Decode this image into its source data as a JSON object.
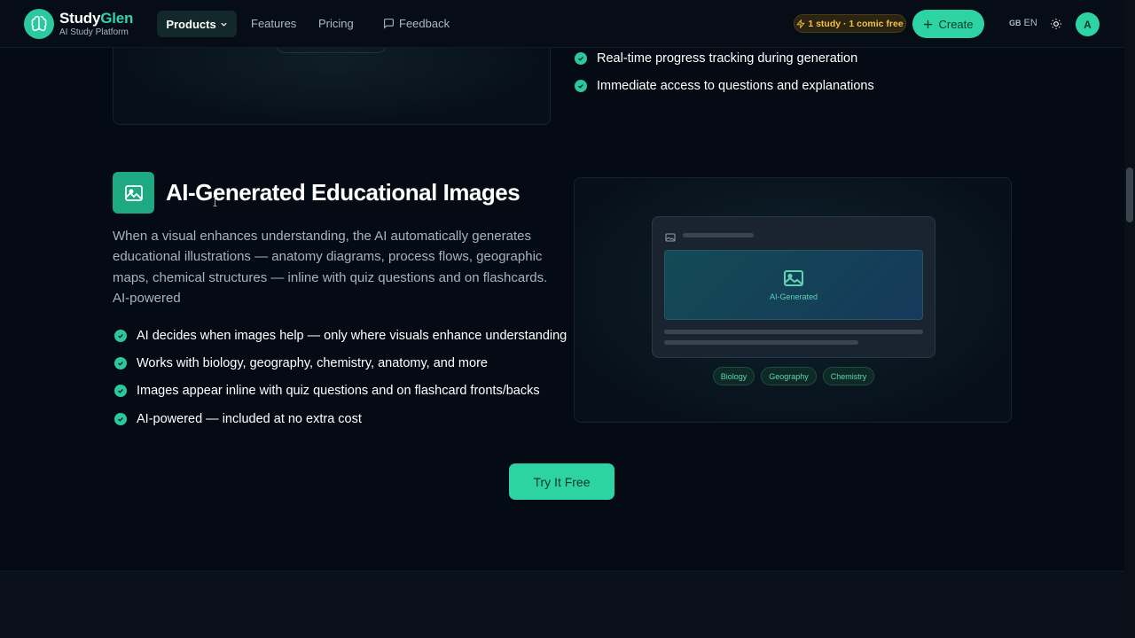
{
  "brand": {
    "name_main": "Study",
    "name_accent": "Glen",
    "subtitle": "AI Study Platform",
    "color": "#2ed3a4"
  },
  "nav": {
    "products": "Products",
    "features": "Features",
    "pricing": "Pricing",
    "feedback": "Feedback"
  },
  "header_right": {
    "free_badge": "1 study · 1 comic free",
    "create": "Create",
    "lang_flag": "GB",
    "lang": "EN",
    "avatar_initial": "A"
  },
  "top_list": [
    "Real-time progress tracking during generation",
    "Immediate access to questions and explanations"
  ],
  "feature": {
    "icon": "image-icon",
    "title": "AI-Generated Educational Images",
    "description": "When a visual enhances understanding, the AI automatically generates educational illustrations — anatomy diagrams, process flows, geographic maps, chemical structures — inline with quiz questions and on flashcards. AI-powered",
    "bullets": [
      "AI decides when images help — only where visuals enhance understanding",
      "Works with biology, geography, chemistry, anatomy, and more",
      "Images appear inline with quiz questions and on flashcard fronts/backs",
      "AI-powered — included at no extra cost"
    ]
  },
  "preview": {
    "image_label": "AI-Generated",
    "tags": [
      "Biology",
      "Geography",
      "Chemistry"
    ]
  },
  "cta": {
    "label": "Try It Free"
  }
}
